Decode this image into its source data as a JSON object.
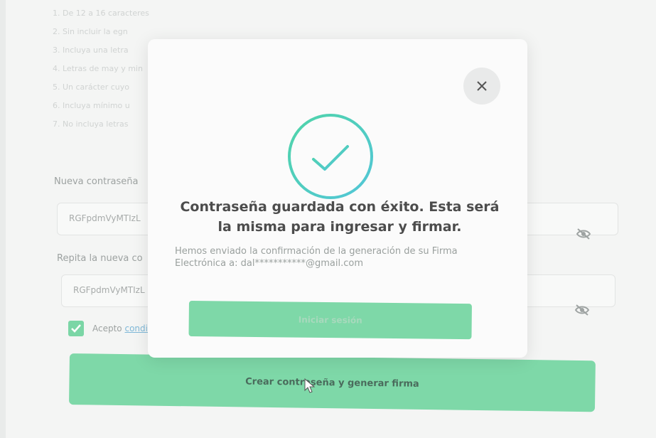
{
  "background_form": {
    "requirements": [
      "1. De 12 a 16 caracteres",
      "2. Sin incluir la egn",
      "3. Incluya una letra",
      "4. Letras de may y min",
      "5. Un carácter cuyo",
      "6. Incluya mínimo u",
      "7. No incluya letras"
    ],
    "new_password_label": "Nueva contraseña",
    "new_password_value": "RGFpdmVyMTIzL",
    "repeat_password_label": "Repita la nueva co",
    "repeat_password_value": "RGFpdmVyMTIzL",
    "accept_label": "Acepto",
    "accept_link": "condi",
    "create_button": "Crear contraseña y generar firma"
  },
  "modal": {
    "title": "Contraseña guardada con éxito. Esta será la misma para ingresar y firmar.",
    "body": "Hemos enviado la confirmación de la generación de su Firma Electrónica a: dal***********@gmail.com",
    "login_button": "Iniciar sesión",
    "close_symbol": "×"
  },
  "colors": {
    "accent_green": "#7ed8a8",
    "success_ring": "#4fd4a8",
    "title_text": "#4c4c4c"
  },
  "icons": [
    "close-icon",
    "check-circle-icon",
    "eye-off-icon",
    "checkbox-checked-icon",
    "mouse-pointer-icon"
  ]
}
